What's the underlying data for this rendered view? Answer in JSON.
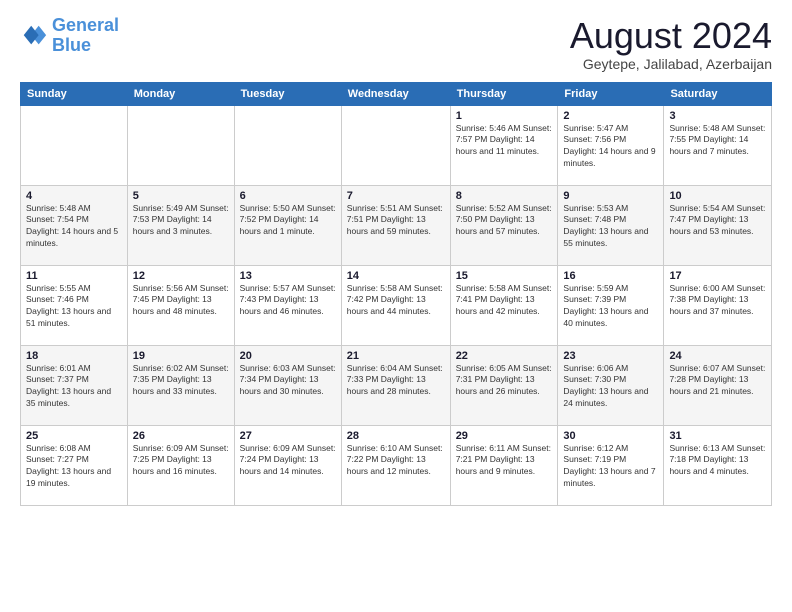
{
  "logo": {
    "line1": "General",
    "line2": "Blue"
  },
  "header": {
    "title": "August 2024",
    "subtitle": "Geytepe, Jalilabad, Azerbaijan"
  },
  "weekdays": [
    "Sunday",
    "Monday",
    "Tuesday",
    "Wednesday",
    "Thursday",
    "Friday",
    "Saturday"
  ],
  "weeks": [
    [
      {
        "day": "",
        "info": ""
      },
      {
        "day": "",
        "info": ""
      },
      {
        "day": "",
        "info": ""
      },
      {
        "day": "",
        "info": ""
      },
      {
        "day": "1",
        "info": "Sunrise: 5:46 AM\nSunset: 7:57 PM\nDaylight: 14 hours\nand 11 minutes."
      },
      {
        "day": "2",
        "info": "Sunrise: 5:47 AM\nSunset: 7:56 PM\nDaylight: 14 hours\nand 9 minutes."
      },
      {
        "day": "3",
        "info": "Sunrise: 5:48 AM\nSunset: 7:55 PM\nDaylight: 14 hours\nand 7 minutes."
      }
    ],
    [
      {
        "day": "4",
        "info": "Sunrise: 5:48 AM\nSunset: 7:54 PM\nDaylight: 14 hours\nand 5 minutes."
      },
      {
        "day": "5",
        "info": "Sunrise: 5:49 AM\nSunset: 7:53 PM\nDaylight: 14 hours\nand 3 minutes."
      },
      {
        "day": "6",
        "info": "Sunrise: 5:50 AM\nSunset: 7:52 PM\nDaylight: 14 hours\nand 1 minute."
      },
      {
        "day": "7",
        "info": "Sunrise: 5:51 AM\nSunset: 7:51 PM\nDaylight: 13 hours\nand 59 minutes."
      },
      {
        "day": "8",
        "info": "Sunrise: 5:52 AM\nSunset: 7:50 PM\nDaylight: 13 hours\nand 57 minutes."
      },
      {
        "day": "9",
        "info": "Sunrise: 5:53 AM\nSunset: 7:48 PM\nDaylight: 13 hours\nand 55 minutes."
      },
      {
        "day": "10",
        "info": "Sunrise: 5:54 AM\nSunset: 7:47 PM\nDaylight: 13 hours\nand 53 minutes."
      }
    ],
    [
      {
        "day": "11",
        "info": "Sunrise: 5:55 AM\nSunset: 7:46 PM\nDaylight: 13 hours\nand 51 minutes."
      },
      {
        "day": "12",
        "info": "Sunrise: 5:56 AM\nSunset: 7:45 PM\nDaylight: 13 hours\nand 48 minutes."
      },
      {
        "day": "13",
        "info": "Sunrise: 5:57 AM\nSunset: 7:43 PM\nDaylight: 13 hours\nand 46 minutes."
      },
      {
        "day": "14",
        "info": "Sunrise: 5:58 AM\nSunset: 7:42 PM\nDaylight: 13 hours\nand 44 minutes."
      },
      {
        "day": "15",
        "info": "Sunrise: 5:58 AM\nSunset: 7:41 PM\nDaylight: 13 hours\nand 42 minutes."
      },
      {
        "day": "16",
        "info": "Sunrise: 5:59 AM\nSunset: 7:39 PM\nDaylight: 13 hours\nand 40 minutes."
      },
      {
        "day": "17",
        "info": "Sunrise: 6:00 AM\nSunset: 7:38 PM\nDaylight: 13 hours\nand 37 minutes."
      }
    ],
    [
      {
        "day": "18",
        "info": "Sunrise: 6:01 AM\nSunset: 7:37 PM\nDaylight: 13 hours\nand 35 minutes."
      },
      {
        "day": "19",
        "info": "Sunrise: 6:02 AM\nSunset: 7:35 PM\nDaylight: 13 hours\nand 33 minutes."
      },
      {
        "day": "20",
        "info": "Sunrise: 6:03 AM\nSunset: 7:34 PM\nDaylight: 13 hours\nand 30 minutes."
      },
      {
        "day": "21",
        "info": "Sunrise: 6:04 AM\nSunset: 7:33 PM\nDaylight: 13 hours\nand 28 minutes."
      },
      {
        "day": "22",
        "info": "Sunrise: 6:05 AM\nSunset: 7:31 PM\nDaylight: 13 hours\nand 26 minutes."
      },
      {
        "day": "23",
        "info": "Sunrise: 6:06 AM\nSunset: 7:30 PM\nDaylight: 13 hours\nand 24 minutes."
      },
      {
        "day": "24",
        "info": "Sunrise: 6:07 AM\nSunset: 7:28 PM\nDaylight: 13 hours\nand 21 minutes."
      }
    ],
    [
      {
        "day": "25",
        "info": "Sunrise: 6:08 AM\nSunset: 7:27 PM\nDaylight: 13 hours\nand 19 minutes."
      },
      {
        "day": "26",
        "info": "Sunrise: 6:09 AM\nSunset: 7:25 PM\nDaylight: 13 hours\nand 16 minutes."
      },
      {
        "day": "27",
        "info": "Sunrise: 6:09 AM\nSunset: 7:24 PM\nDaylight: 13 hours\nand 14 minutes."
      },
      {
        "day": "28",
        "info": "Sunrise: 6:10 AM\nSunset: 7:22 PM\nDaylight: 13 hours\nand 12 minutes."
      },
      {
        "day": "29",
        "info": "Sunrise: 6:11 AM\nSunset: 7:21 PM\nDaylight: 13 hours\nand 9 minutes."
      },
      {
        "day": "30",
        "info": "Sunrise: 6:12 AM\nSunset: 7:19 PM\nDaylight: 13 hours\nand 7 minutes."
      },
      {
        "day": "31",
        "info": "Sunrise: 6:13 AM\nSunset: 7:18 PM\nDaylight: 13 hours\nand 4 minutes."
      }
    ]
  ]
}
